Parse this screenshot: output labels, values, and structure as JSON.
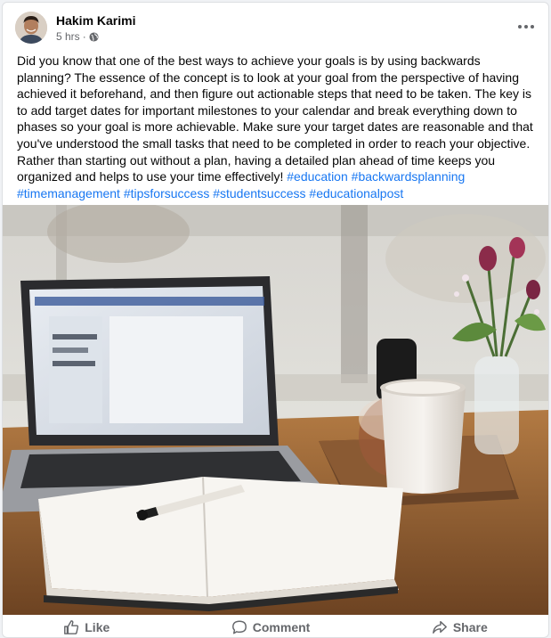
{
  "post": {
    "author": "Hakim Karimi",
    "time": "5 hrs",
    "separator": "·",
    "privacy_icon": "globe-icon",
    "body_text": "Did you know that one of the best ways to achieve your goals is by using backwards planning? The essence of the concept is to look at your goal from the perspective of having achieved it beforehand, and then figure out actionable steps that need to be taken. The key is to add target dates for important milestones to your calendar and break everything down to phases so your goal is more achievable. Make sure your target dates are reasonable and that you've understood the small tasks that need to be completed in order to reach your objective. Rather than starting out without a plan, having a detailed plan ahead of time keeps you organized and helps to use your time effectively!",
    "hashtags": [
      "#education",
      "#backwardsplanning",
      "#timemanagement",
      "#tipsforsuccess",
      "#studentsuccess",
      "#educationalpost"
    ]
  },
  "actions": {
    "like": "Like",
    "comment": "Comment",
    "share": "Share"
  },
  "colors": {
    "link": "#1877f2",
    "secondary_text": "#65676b",
    "primary_text": "#050505"
  }
}
